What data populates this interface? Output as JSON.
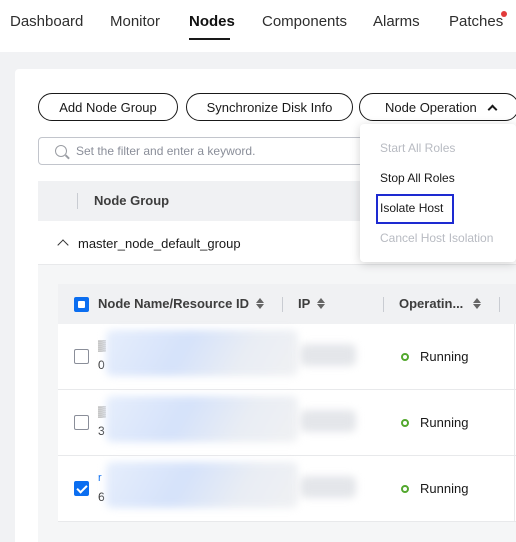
{
  "tabs": {
    "dashboard": "Dashboard",
    "monitor": "Monitor",
    "nodes": "Nodes",
    "components": "Components",
    "alarms": "Alarms",
    "patches": "Patches"
  },
  "toolbar": {
    "add_node_group": "Add Node Group",
    "sync_disk_info": "Synchronize Disk Info",
    "node_operation": "Node Operation"
  },
  "filter": {
    "placeholder": "Set the filter and enter a keyword."
  },
  "outer_table": {
    "header_node_group": "Node Group",
    "group_name": "master_node_default_group"
  },
  "inner_table": {
    "col_name": "Node Name/Resource ID",
    "col_ip": "IP",
    "col_status": "Operatin...",
    "rows": [
      {
        "name_glyph": "▒",
        "id_glyph": "0",
        "status": "Running",
        "checked": false
      },
      {
        "name_glyph": "▒",
        "id_glyph": "3",
        "status": "Running",
        "checked": false
      },
      {
        "name_glyph": "r",
        "id_glyph": "6",
        "status": "Running",
        "checked": true
      }
    ]
  },
  "node_operation_menu": {
    "items": [
      {
        "label": "Start All Roles",
        "enabled": false
      },
      {
        "label": "Stop All Roles",
        "enabled": true
      },
      {
        "label": "Isolate Host",
        "enabled": true,
        "highlighted": true
      },
      {
        "label": "Cancel Host Isolation",
        "enabled": false
      }
    ]
  },
  "colors": {
    "accent": "#0b6ef0",
    "running_status": "#53a82e",
    "notification_dot": "#e23b3b",
    "highlight_box": "#1d2ad1"
  }
}
